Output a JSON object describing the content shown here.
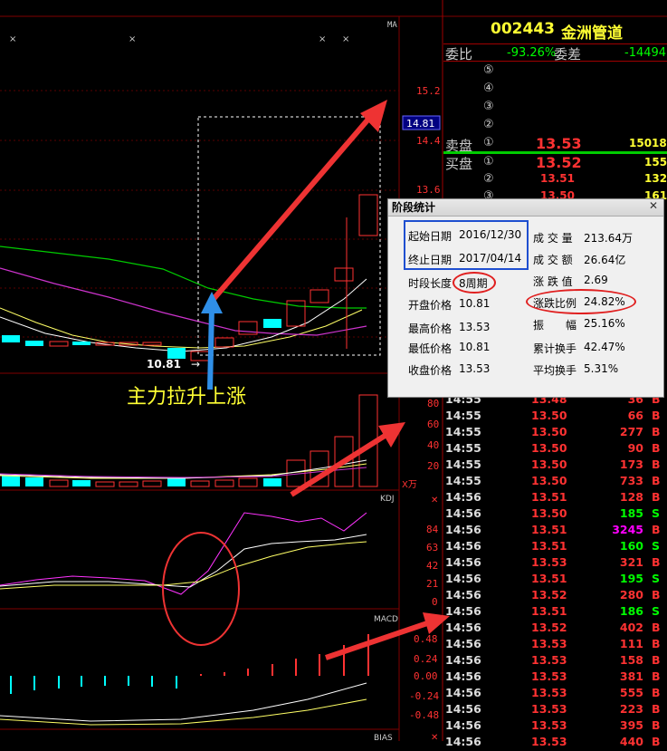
{
  "stock": {
    "code": "002443",
    "name": "金洲管道"
  },
  "weibi": {
    "label1": "委比",
    "val1": "-93.26%",
    "label2": "委差",
    "val2": "-14494"
  },
  "book": {
    "sell_levels": [
      "⑤",
      "④",
      "③",
      "②"
    ],
    "sell1": {
      "side": "卖盘",
      "lvl": "①",
      "price": "13.53",
      "vol": "15018"
    },
    "buy1": {
      "side": "买盘",
      "lvl": "①",
      "price": "13.52",
      "vol": "155"
    },
    "buy_levels": [
      {
        "lvl": "②",
        "price": "13.51",
        "vol": "132"
      },
      {
        "lvl": "③",
        "price": "13.50",
        "vol": "161"
      }
    ]
  },
  "axis": {
    "ma_label": "MA",
    "vol_label": "VO",
    "vol_unit": "X万",
    "kdj_label": "KDJ",
    "macd_label": "MACD",
    "bias_label": "BIAS",
    "price_ticks": [
      "15.2",
      "14.4",
      "13.6"
    ],
    "current_price": "14.81",
    "vol_ticks": [
      "80",
      "60",
      "40",
      "20"
    ],
    "kdj_ticks": [
      "84",
      "63",
      "42",
      "21",
      "0"
    ],
    "macd_ticks": [
      "0.48",
      "0.24",
      "0.00",
      "-0.24",
      "-0.48"
    ],
    "low_marker": "10.81"
  },
  "annotation": "主力拉升上涨",
  "panel": {
    "title": "阶段统计",
    "close_glyph": "✕",
    "start_label": "起始日期",
    "start": "2016/12/30",
    "end_label": "终止日期",
    "end": "2017/04/14",
    "period_label": "时段长度",
    "period": "8周期",
    "open_label": "开盘价格",
    "open": "10.81",
    "high_label": "最高价格",
    "high": "13.53",
    "low_label": "最低价格",
    "low": "10.81",
    "close_label": "收盘价格",
    "close": "13.53",
    "vol_label": "成 交 量",
    "vol": "213.64万",
    "amt_label": "成 交 额",
    "amt": "26.64亿",
    "chg_label": "涨 跌 值",
    "chg": "2.69",
    "pct_label": "涨跌比例",
    "pct": "24.82%",
    "amp_label": "振　　幅",
    "amp": "25.16%",
    "turn_label": "累计换手",
    "turn": "42.47%",
    "avgturn_label": "平均换手",
    "avgturn": "5.31%"
  },
  "ticks": [
    {
      "t": "14:55",
      "p": "13.48",
      "v": "36",
      "s": "B"
    },
    {
      "t": "14:55",
      "p": "13.50",
      "v": "66",
      "s": "B"
    },
    {
      "t": "14:55",
      "p": "13.50",
      "v": "277",
      "s": "B"
    },
    {
      "t": "14:55",
      "p": "13.50",
      "v": "90",
      "s": "B"
    },
    {
      "t": "14:55",
      "p": "13.50",
      "v": "173",
      "s": "B"
    },
    {
      "t": "14:55",
      "p": "13.50",
      "v": "733",
      "s": "B"
    },
    {
      "t": "14:56",
      "p": "13.51",
      "v": "128",
      "s": "B"
    },
    {
      "t": "14:56",
      "p": "13.50",
      "v": "185",
      "s": "S"
    },
    {
      "t": "14:56",
      "p": "13.51",
      "v": "3245",
      "s": "B"
    },
    {
      "t": "14:56",
      "p": "13.51",
      "v": "160",
      "s": "S"
    },
    {
      "t": "14:56",
      "p": "13.53",
      "v": "321",
      "s": "B"
    },
    {
      "t": "14:56",
      "p": "13.51",
      "v": "195",
      "s": "S"
    },
    {
      "t": "14:56",
      "p": "13.52",
      "v": "280",
      "s": "B"
    },
    {
      "t": "14:56",
      "p": "13.51",
      "v": "186",
      "s": "S"
    },
    {
      "t": "14:56",
      "p": "13.52",
      "v": "402",
      "s": "B"
    },
    {
      "t": "14:56",
      "p": "13.53",
      "v": "111",
      "s": "B"
    },
    {
      "t": "14:56",
      "p": "13.53",
      "v": "158",
      "s": "B"
    },
    {
      "t": "14:56",
      "p": "13.53",
      "v": "381",
      "s": "B"
    },
    {
      "t": "14:56",
      "p": "13.53",
      "v": "555",
      "s": "B"
    },
    {
      "t": "14:56",
      "p": "13.53",
      "v": "223",
      "s": "B"
    },
    {
      "t": "14:56",
      "p": "13.53",
      "v": "395",
      "s": "B"
    },
    {
      "t": "14:56",
      "p": "13.53",
      "v": "440",
      "s": "B"
    }
  ],
  "colors": {
    "up": "#ff3232",
    "down": "#00ffff",
    "buy": "#ff3232",
    "sell": "#00ff00",
    "big": "#ff00ff",
    "grid": "#800000"
  }
}
